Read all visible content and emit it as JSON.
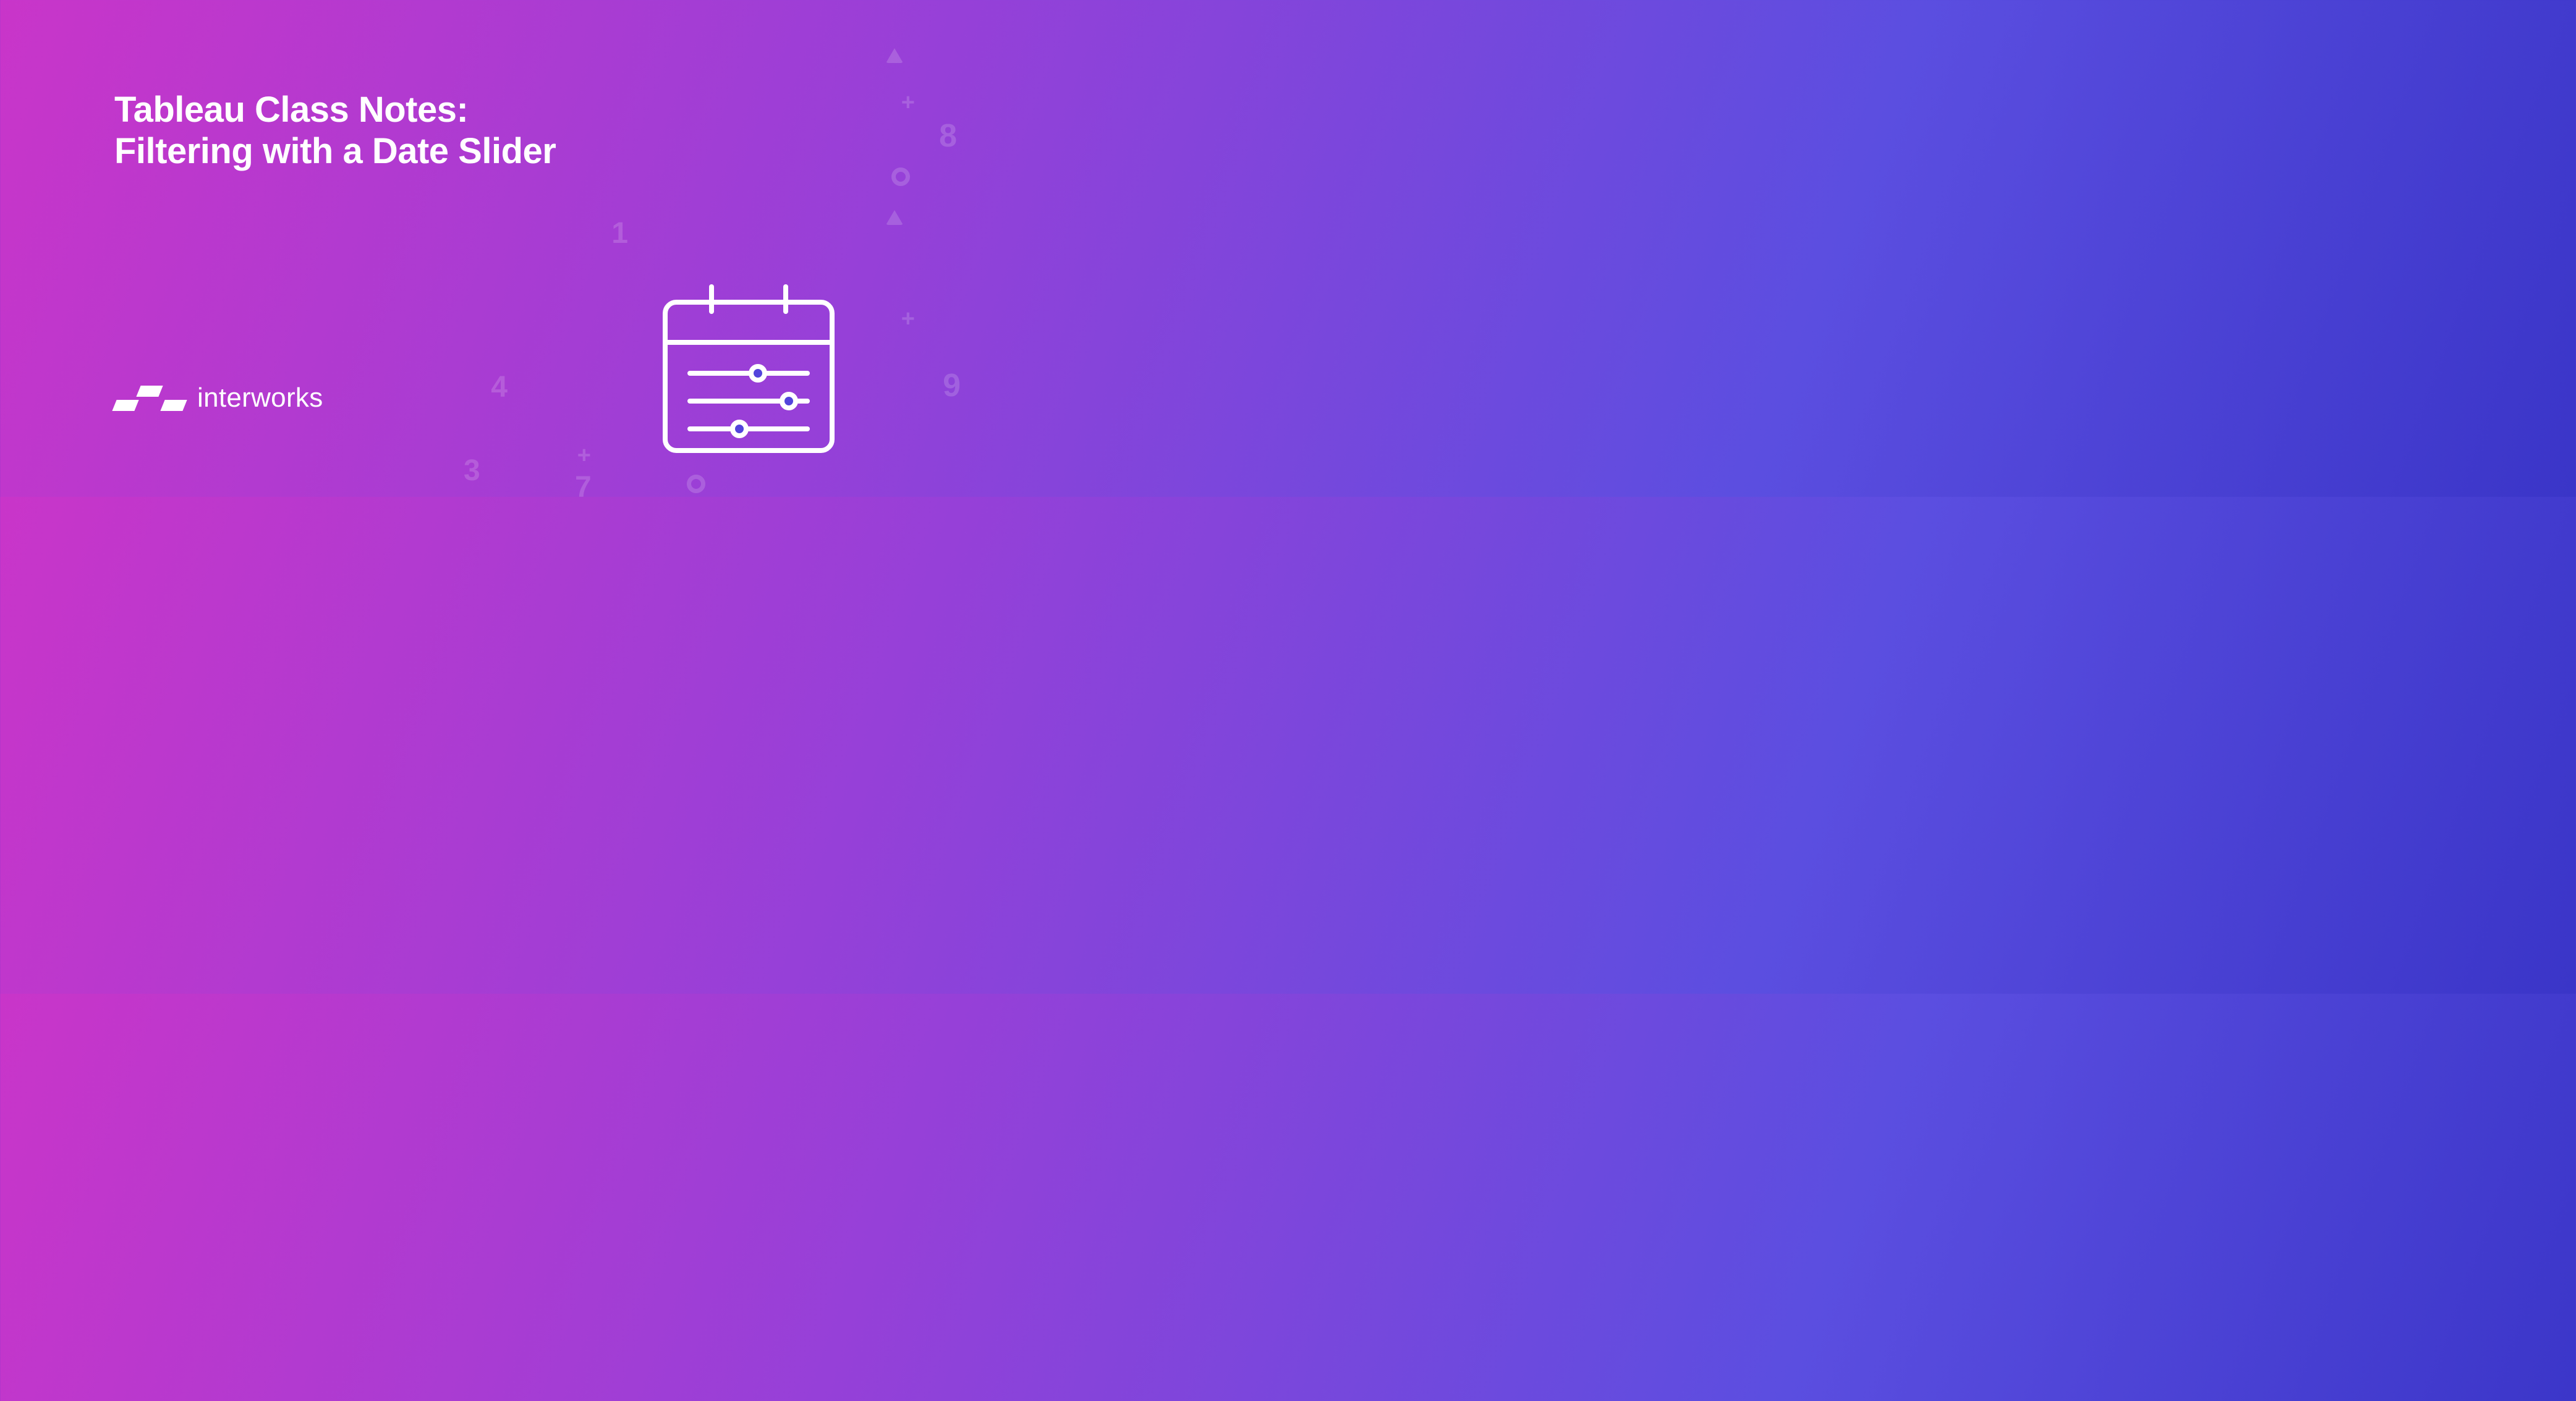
{
  "title_line1": "Tableau Class Notes:",
  "title_line2": "Filtering with a Date Slider",
  "logo_text": "interworks",
  "decorations": {
    "num_1": "1",
    "num_4": "4",
    "num_8": "8",
    "num_9": "9",
    "num_3": "3",
    "num_7": "7",
    "plus": "+"
  }
}
